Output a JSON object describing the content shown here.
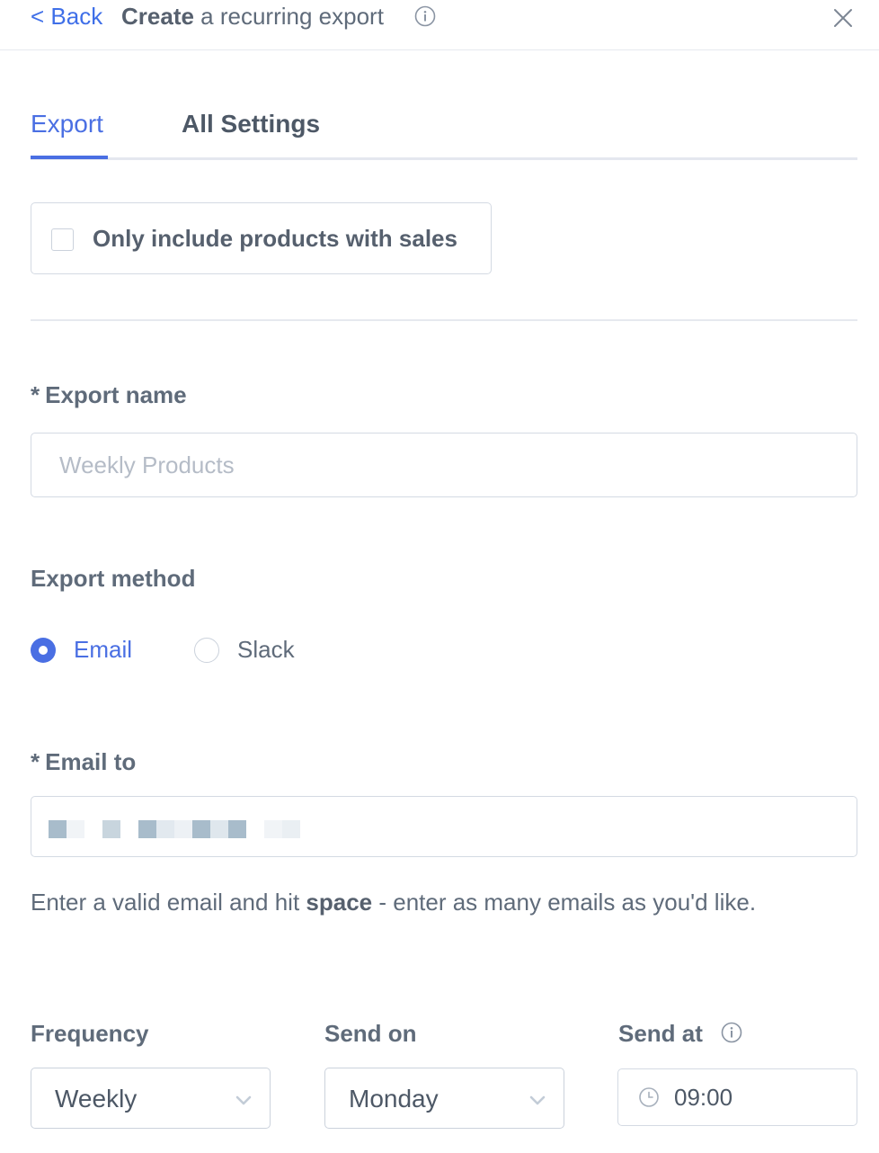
{
  "header": {
    "back_label": "< Back",
    "title_bold": "Create",
    "title_rest": " a recurring export"
  },
  "tabs": [
    {
      "label": "Export",
      "active": true
    },
    {
      "label": "All Settings",
      "active": false
    }
  ],
  "only_sales": {
    "label": "Only include products with sales",
    "checked": false
  },
  "export_name": {
    "required_mark": "*",
    "label": "Export name",
    "value": "",
    "placeholder": "Weekly Products"
  },
  "export_method": {
    "label": "Export method",
    "options": [
      {
        "label": "Email",
        "selected": true
      },
      {
        "label": "Slack",
        "selected": false
      }
    ]
  },
  "email_to": {
    "required_mark": "*",
    "label": "Email to",
    "helper_before": "Enter a valid email and hit ",
    "helper_bold": "space",
    "helper_after": " - enter as many emails as you'd like."
  },
  "frequency": {
    "label": "Frequency",
    "value": "Weekly"
  },
  "send_on": {
    "label": "Send on",
    "value": "Monday"
  },
  "send_at": {
    "label": "Send at",
    "value": "09:00"
  },
  "colors": {
    "accent": "#4a6fe3",
    "text": "#5f6b7a",
    "border": "#d4dae3"
  },
  "icons": [
    "info-icon",
    "close-icon",
    "chevron-down-icon",
    "clock-icon"
  ]
}
